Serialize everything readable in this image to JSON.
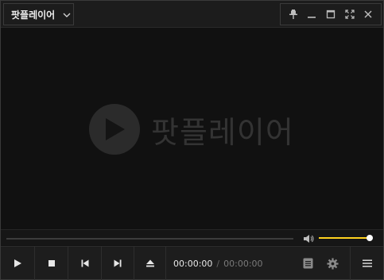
{
  "app": {
    "menu_label": "팟플레이어",
    "logo_text": "팟플레이어"
  },
  "window_controls": [
    "pin-icon",
    "minimize-icon",
    "maximize-icon",
    "fullscreen-icon",
    "close-icon"
  ],
  "playback": {
    "position": 0,
    "current_time": "00:00:00",
    "separator": "/",
    "duration": "00:00:00"
  },
  "volume": {
    "level": 1.0,
    "color": "#ffd21f"
  },
  "control_buttons": [
    "play-icon",
    "stop-icon",
    "previous-icon",
    "next-icon",
    "eject-icon",
    "playlist-icon",
    "settings-icon",
    "menu-icon"
  ],
  "colors": {
    "background": "#111111",
    "accent": "#ffd21f"
  }
}
